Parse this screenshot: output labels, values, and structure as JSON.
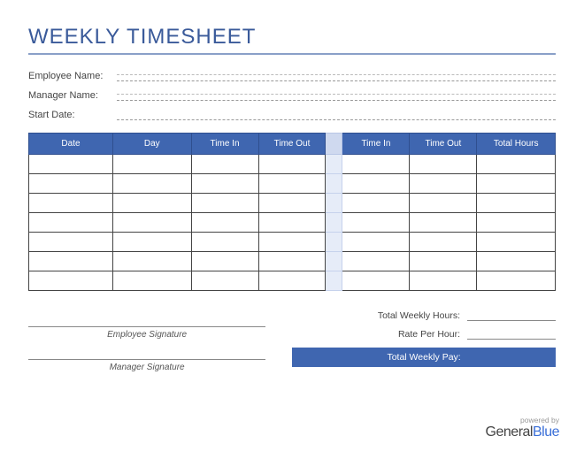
{
  "title": "WEEKLY TIMESHEET",
  "info": {
    "employee_label": "Employee Name:",
    "manager_label": "Manager Name:",
    "start_date_label": "Start Date:"
  },
  "columns": {
    "date": "Date",
    "day": "Day",
    "time_in_1": "Time In",
    "time_out_1": "Time Out",
    "gap": "",
    "time_in_2": "Time In",
    "time_out_2": "Time Out",
    "total_hours": "Total Hours"
  },
  "rows": [
    {
      "date": "",
      "day": "",
      "in1": "",
      "out1": "",
      "in2": "",
      "out2": "",
      "total": ""
    },
    {
      "date": "",
      "day": "",
      "in1": "",
      "out1": "",
      "in2": "",
      "out2": "",
      "total": ""
    },
    {
      "date": "",
      "day": "",
      "in1": "",
      "out1": "",
      "in2": "",
      "out2": "",
      "total": ""
    },
    {
      "date": "",
      "day": "",
      "in1": "",
      "out1": "",
      "in2": "",
      "out2": "",
      "total": ""
    },
    {
      "date": "",
      "day": "",
      "in1": "",
      "out1": "",
      "in2": "",
      "out2": "",
      "total": ""
    },
    {
      "date": "",
      "day": "",
      "in1": "",
      "out1": "",
      "in2": "",
      "out2": "",
      "total": ""
    },
    {
      "date": "",
      "day": "",
      "in1": "",
      "out1": "",
      "in2": "",
      "out2": "",
      "total": ""
    }
  ],
  "signatures": {
    "employee": "Employee Signature",
    "manager": "Manager Signature"
  },
  "totals": {
    "weekly_hours_label": "Total Weekly Hours:",
    "rate_label": "Rate Per Hour:",
    "pay_label": "Total Weekly Pay:"
  },
  "footer": {
    "powered": "powered by",
    "brand_a": "General",
    "brand_b": "Blue"
  }
}
